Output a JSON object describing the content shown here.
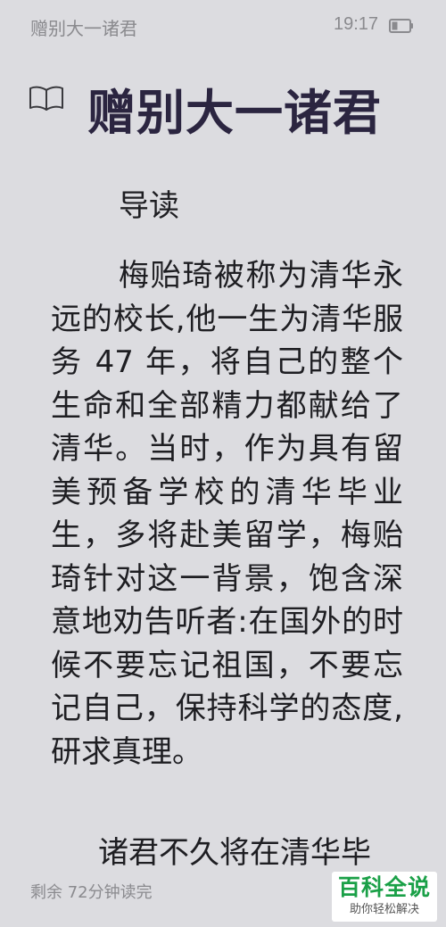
{
  "status_bar": {
    "title": "赠别大一诸君",
    "time": "19:17",
    "icons": [
      "battery-icon"
    ]
  },
  "chapter": {
    "icon": "open-book-icon",
    "title": "赠别大一诸君"
  },
  "content": {
    "heading": "导读",
    "paragraph": "梅贻琦被称为清华永远的校长,他一生为清华服务 47 年，将自己的整个生命和全部精力都献给了清华。当时，作为具有留美预备学校的清华毕业生，多将赴美留学，梅贻琦针对这一背景，饱含深意地劝告听者:在国外的时候不要忘记祖国，不要忘记自己，保持科学的态度,研求真理。",
    "next_paragraph_start": "诸君不久将在清华毕"
  },
  "footer": {
    "remaining": "剩余 72分钟读完"
  },
  "watermark": {
    "main": "百科全说",
    "sub": "助你轻松解决"
  },
  "colors": {
    "background": "#dcdce0",
    "title": "#2b2540",
    "text": "#1e1e22",
    "muted": "#8a8a8e",
    "watermark_green": "#1aa047"
  }
}
